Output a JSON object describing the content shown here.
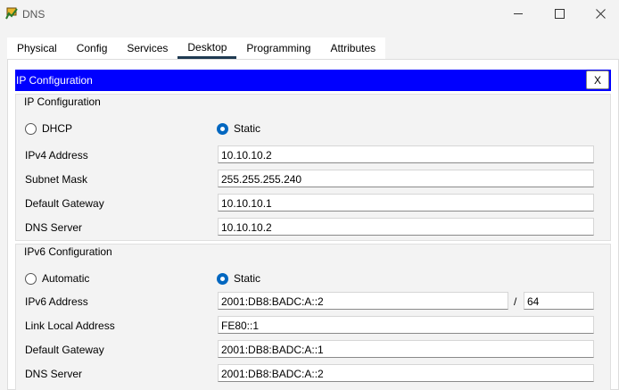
{
  "window": {
    "title": "DNS",
    "minimize_glyph": "—",
    "maximize_glyph": "☐",
    "close_glyph": "✕",
    "app_icon": "packet-tracer-pc-icon"
  },
  "tabs": [
    {
      "label": "Physical",
      "active": false
    },
    {
      "label": "Config",
      "active": false
    },
    {
      "label": "Services",
      "active": false
    },
    {
      "label": "Desktop",
      "active": true
    },
    {
      "label": "Programming",
      "active": false
    },
    {
      "label": "Attributes",
      "active": false
    }
  ],
  "ip_config_bar": {
    "title": "IP Configuration",
    "close_label": "X",
    "color": "#0000ff"
  },
  "ipv4": {
    "group_title": "IP Configuration",
    "dhcp_label": "DHCP",
    "static_label": "Static",
    "selected_mode": "Static",
    "ipv4_address_label": "IPv4 Address",
    "ipv4_address": "10.10.10.2",
    "subnet_mask_label": "Subnet Mask",
    "subnet_mask": "255.255.255.240",
    "gateway_label": "Default Gateway",
    "gateway": "10.10.10.1",
    "dns_label": "DNS Server",
    "dns": "10.10.10.2"
  },
  "ipv6": {
    "group_title": "IPv6 Configuration",
    "automatic_label": "Automatic",
    "static_label": "Static",
    "selected_mode": "Static",
    "ipv6_address_label": "IPv6 Address",
    "ipv6_address": "2001:DB8:BADC:A::2",
    "prefix_separator": "/",
    "prefix_length": "64",
    "link_local_label": "Link Local Address",
    "link_local": "FE80::1",
    "gateway_label": "Default Gateway",
    "gateway": "2001:DB8:BADC:A::1",
    "dns_label": "DNS Server",
    "dns": "2001:DB8:BADC:A::2"
  }
}
